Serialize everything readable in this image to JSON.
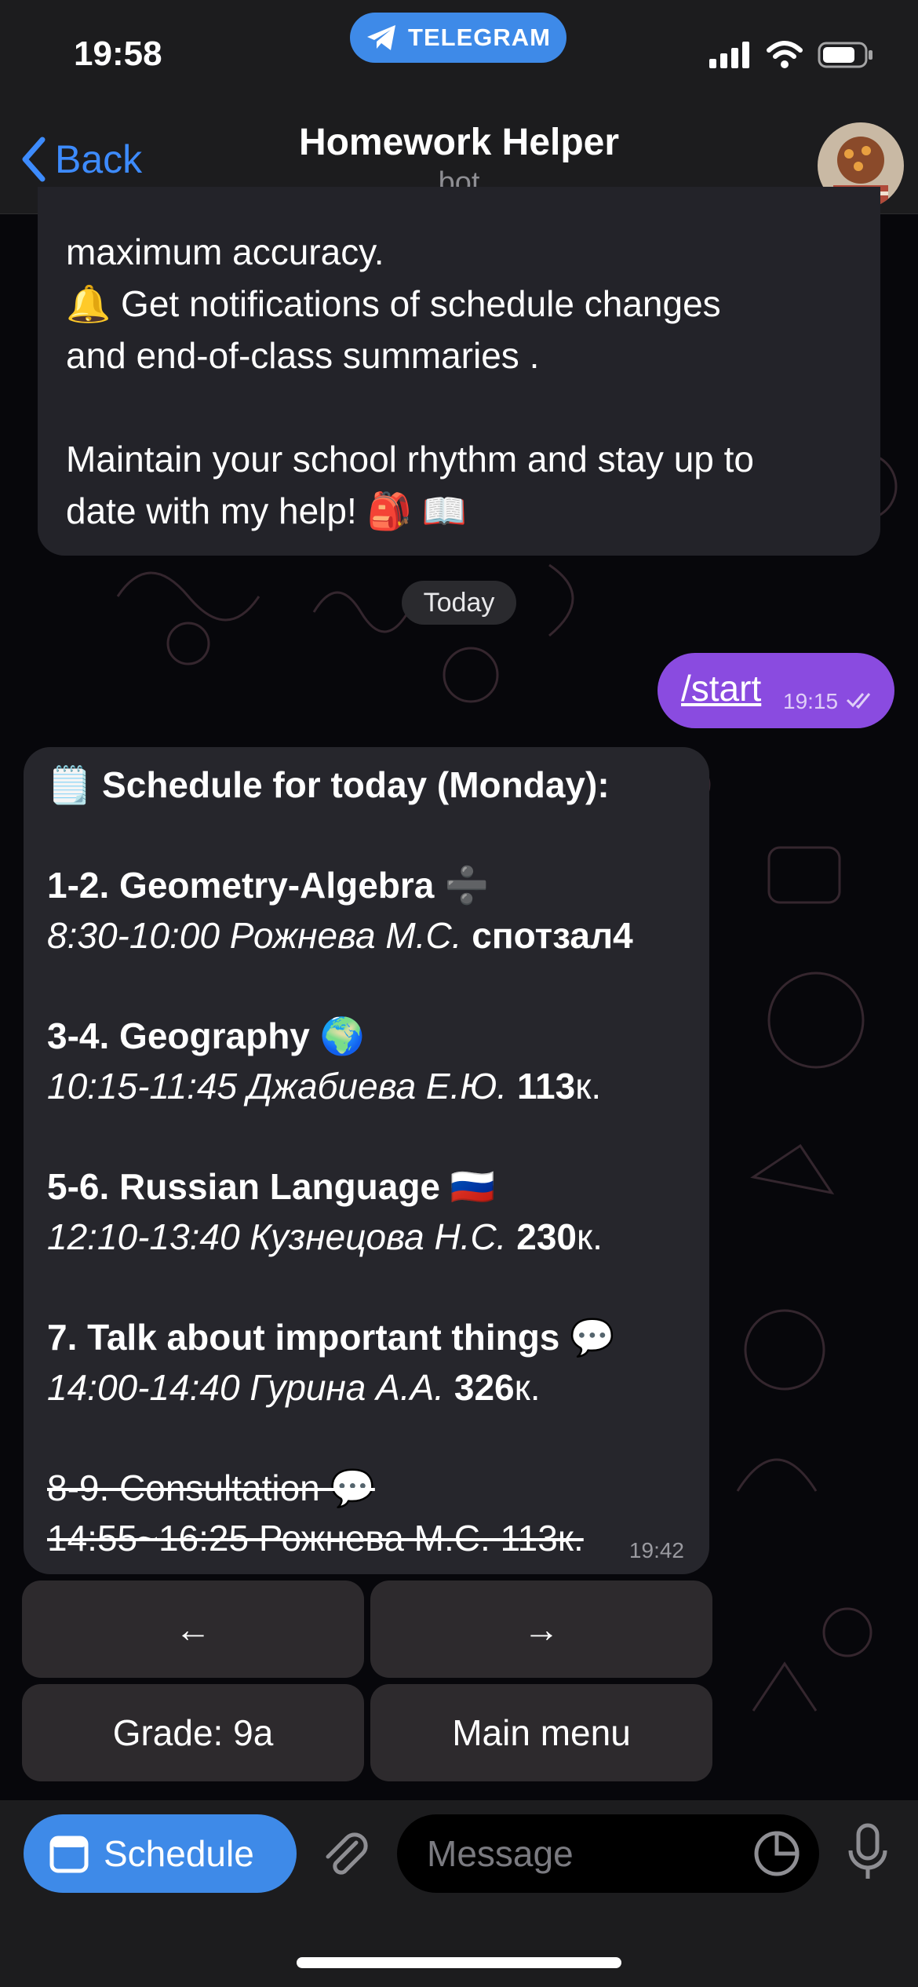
{
  "status_bar": {
    "time": "19:58",
    "app_pill": "TELEGRAM"
  },
  "header": {
    "back_label": "Back",
    "title": "Homework Helper",
    "subtitle": "bot"
  },
  "intro_message": {
    "lines": [
      "maximum accuracy.",
      "🔔 Get notifications of schedule changes",
      "and end-of-class summaries .",
      "",
      "Maintain your school rhythm and stay up to",
      "date with my help! 🎒 📖"
    ]
  },
  "date_separator": "Today",
  "outgoing": {
    "text": "/start",
    "time": "19:15"
  },
  "schedule_message": {
    "heading": "🗒️ Schedule for today (Monday):",
    "lessons": [
      {
        "title": "1-2. Geometry-Algebra ➗",
        "time_teacher": "8:30-10:00 Рожнева М.С.",
        "room_num": "спотзал4",
        "room_suffix": ""
      },
      {
        "title": "3-4. Geography 🌍",
        "time_teacher": "10:15-11:45 Джабиева Е.Ю.",
        "room_num": "113",
        "room_suffix": "к."
      },
      {
        "title": "5-6. Russian Language 🇷🇺",
        "time_teacher": "12:10-13:40 Кузнецова Н.С.",
        "room_num": "230",
        "room_suffix": "к."
      },
      {
        "title": "7. Talk about important things 💬",
        "time_teacher": "14:00-14:40 Гурина А.А.",
        "room_num": "326",
        "room_suffix": "к."
      }
    ],
    "cancelled": {
      "title": "8-9. Consultation 💬",
      "detail": "14:55~16:25 Рожнева М.С. 113к."
    },
    "time": "19:42"
  },
  "keyboard": {
    "prev": "←",
    "next": "→",
    "grade": "Grade: 9a",
    "main_menu": "Main menu"
  },
  "composer": {
    "schedule_label": "Schedule",
    "placeholder": "Message"
  },
  "colors": {
    "accent": "#3e8ae8",
    "outgoing_bubble": "#8a4be0",
    "incoming_bubble": "#232329",
    "back_link": "#3d8bfd"
  },
  "icons": [
    "telegram-icon",
    "signal-icon",
    "wifi-icon",
    "battery-icon",
    "chevron-left-icon",
    "calendar-icon",
    "paperclip-icon",
    "sticker-icon",
    "microphone-icon",
    "double-check-icon"
  ]
}
